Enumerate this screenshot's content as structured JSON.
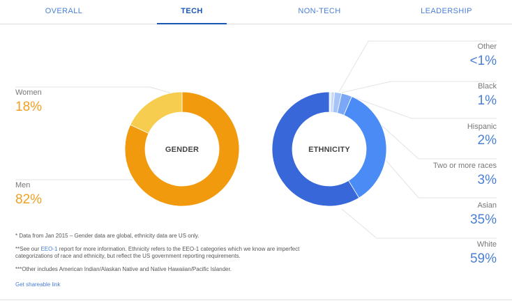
{
  "tabs": [
    {
      "label": "OVERALL",
      "active": false
    },
    {
      "label": "TECH",
      "active": true
    },
    {
      "label": "NON-TECH",
      "active": false
    },
    {
      "label": "LEADERSHIP",
      "active": false
    }
  ],
  "gender": {
    "center_label": "GENDER",
    "women": {
      "label": "Women",
      "value": "18%"
    },
    "men": {
      "label": "Men",
      "value": "82%"
    }
  },
  "ethnicity": {
    "center_label": "ETHNICITY",
    "items": [
      {
        "label": "Other",
        "value": "<1%"
      },
      {
        "label": "Black",
        "value": "1%"
      },
      {
        "label": "Hispanic",
        "value": "2%"
      },
      {
        "label": "Two or more races",
        "value": "3%"
      },
      {
        "label": "Asian",
        "value": "35%"
      },
      {
        "label": "White",
        "value": "59%"
      }
    ]
  },
  "chart_data": [
    {
      "type": "pie",
      "title": "GENDER",
      "categories": [
        "Men",
        "Women"
      ],
      "values": [
        82,
        18
      ],
      "colors": [
        "#f19a0e",
        "#f6cd4f"
      ]
    },
    {
      "type": "pie",
      "title": "ETHNICITY",
      "categories": [
        "White",
        "Asian",
        "Two or more races",
        "Hispanic",
        "Black",
        "Other"
      ],
      "values": [
        59,
        35,
        3,
        2,
        1,
        0.5
      ],
      "colors": [
        "#3767d8",
        "#4a8bf5",
        "#7aa8f7",
        "#a7c4f9",
        "#c8daf9",
        "#e1ebfb"
      ]
    }
  ],
  "notes": {
    "note1": "* Data from Jan 2015 – Gender data are global, ethnicity data are US only.",
    "note2_prefix": "**See our ",
    "note2_link": "EEO-1",
    "note2_suffix": " report for more information. Ethnicity refers to the EEO-1 categories which we know are imperfect categorizations of race and ethnicity, but reflect the US government reporting requirements.",
    "note3": "***Other includes American Indian/Alaskan Native and Native Hawaiian/Pacific Islander."
  },
  "share_link": "Get shareable link"
}
